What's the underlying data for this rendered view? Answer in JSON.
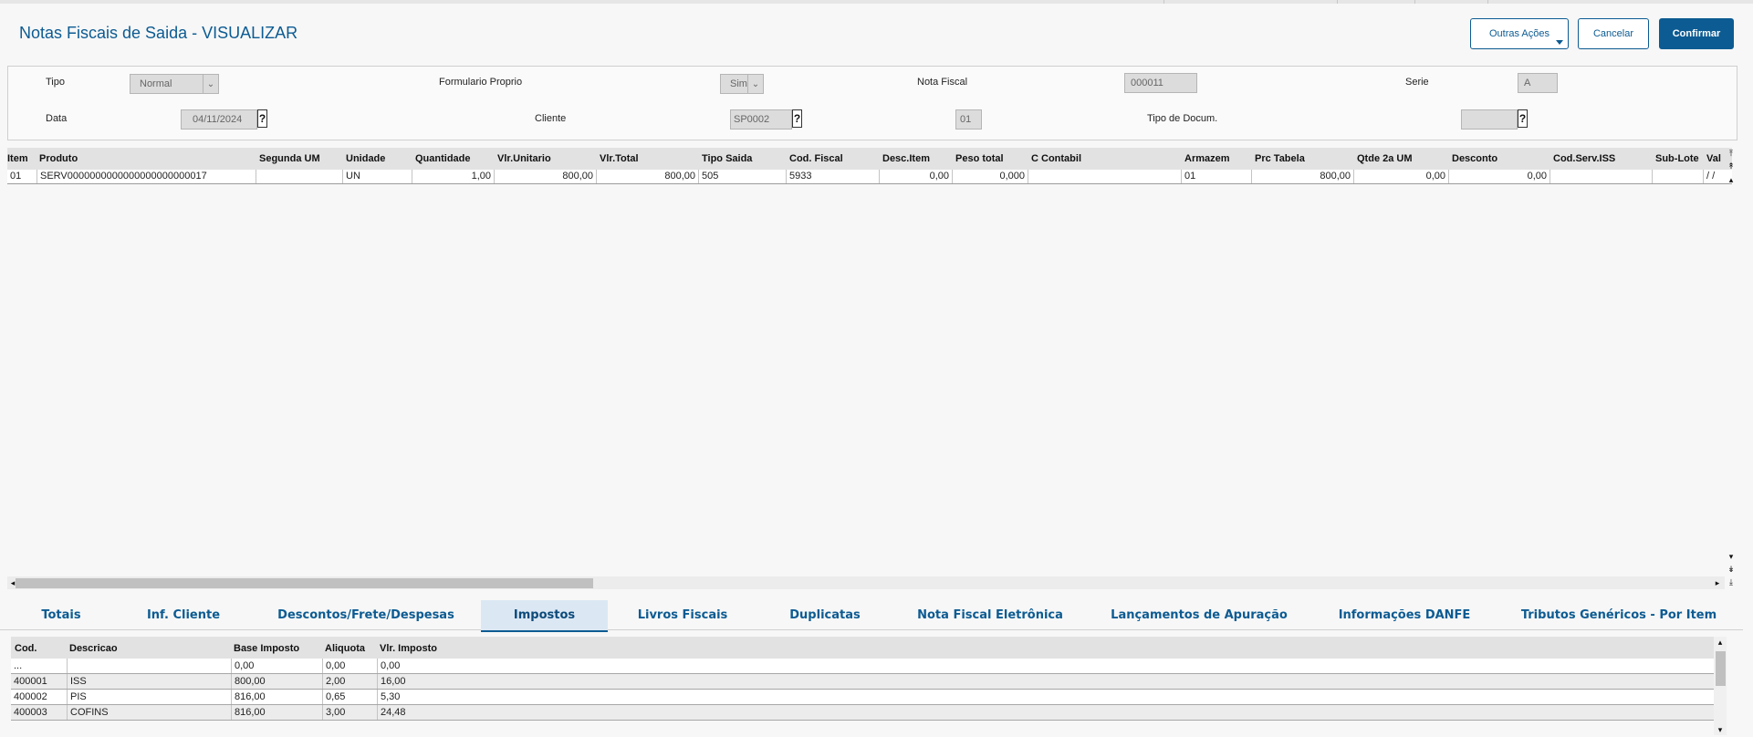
{
  "header": {
    "title": "Notas Fiscais de Saida - VISUALIZAR",
    "buttons": {
      "outras": "Outras Ações",
      "cancelar": "Cancelar",
      "confirmar": "Confirmar"
    }
  },
  "form": {
    "tipo": {
      "label": "Tipo",
      "value": "Normal"
    },
    "formulario": {
      "label": "Formulario Proprio",
      "value": "Sim"
    },
    "nota": {
      "label": "Nota Fiscal",
      "value": "000011"
    },
    "serie": {
      "label": "Serie",
      "value": "A"
    },
    "data": {
      "label": "Data",
      "value": "04/11/2024"
    },
    "cliente": {
      "label": "Cliente",
      "value": "SP0002",
      "loja": "01"
    },
    "tipodoc": {
      "label": "Tipo de Docum.",
      "value": ""
    },
    "lookup_symbol": "?"
  },
  "items_grid": {
    "columns": [
      "Item",
      "Produto",
      "Segunda UM",
      "Unidade",
      "Quantidade",
      "Vlr.Unitario",
      "Vlr.Total",
      "Tipo Saida",
      "Cod. Fiscal",
      "Desc.Item",
      "Peso total",
      "C Contabil",
      "Armazem",
      "Prc Tabela",
      "Qtde 2a UM",
      "Desconto",
      "Cod.Serv.ISS",
      "Sub-Lote",
      "Val"
    ],
    "row": [
      "01",
      "SERV0000000000000000000000017",
      "",
      "UN",
      "1,00",
      "800,00",
      "800,00",
      "505",
      "5933",
      "0,00",
      "0,000",
      "",
      "01",
      "800,00",
      "0,00",
      "0,00",
      "",
      "",
      "/ /"
    ]
  },
  "tabs": [
    "Totais",
    "Inf. Cliente",
    "Descontos/Frete/Despesas",
    "Impostos",
    "Livros Fiscais",
    "Duplicatas",
    "Nota Fiscal Eletrônica",
    "Lançamentos de Apuração",
    "Informações DANFE",
    "Tributos Genéricos - Por Item"
  ],
  "active_tab": "Impostos",
  "tax_grid": {
    "columns": [
      "Cod.",
      "Descricao",
      "Base Imposto",
      "Aliquota",
      "Vlr. Imposto"
    ],
    "rows": [
      [
        "...",
        "",
        "0,00",
        "0,00",
        "0,00"
      ],
      [
        "400001",
        "ISS",
        "800,00",
        "2,00",
        "16,00"
      ],
      [
        "400002",
        "PIS",
        "816,00",
        "0,65",
        "5,30"
      ],
      [
        "400003",
        "COFINS",
        "816,00",
        "3,00",
        "24,48"
      ]
    ]
  },
  "colors": {
    "accent": "#0c5b92",
    "tab_active_bg": "#dbe8f4"
  }
}
